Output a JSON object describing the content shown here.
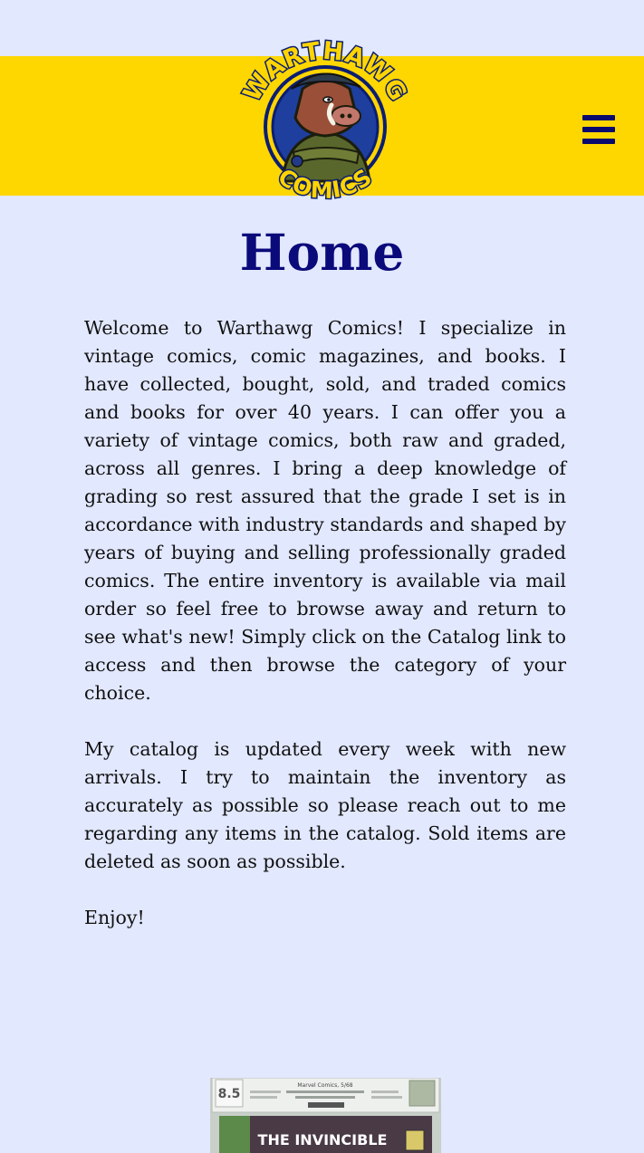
{
  "header": {
    "logo": {
      "top_text": "WARTHAWG",
      "bottom_text": "COMICS",
      "icon": "warthog-mascot-logo"
    },
    "menu_icon": "hamburger-menu-icon",
    "colors": {
      "band": "#ffd700",
      "navy": "#0a0a7a",
      "page_bg": "#e2e8fe"
    }
  },
  "main": {
    "title": "Home",
    "paragraphs": [
      "Welcome to Warthawg Comics! I specialize in vintage comics, comic magazines, and books. I have collected, bought, sold, and traded comics and books for over 40 years. I can offer you a variety of vintage comics, both raw and graded, across all genres. I bring a deep knowledge of grading so rest assured that the grade I set is in accordance with industry standards and shaped by years of buying and selling professionally graded comics. The entire inventory is available via mail order so feel free to browse away and return to see what's new! Simply click on the Catalog link to access and then browse the category of your choice.",
      "My catalog is updated every week with new arrivals. I try to maintain the inventory as accurately as possible so please reach out to me regarding any items in the catalog. Sold items are deleted as soon as possible.",
      "Enjoy!"
    ]
  },
  "featured": {
    "grade": "8.5",
    "label_header": "Marvel Comics, 5/68",
    "cover_title": "THE INVINCIBLE"
  }
}
